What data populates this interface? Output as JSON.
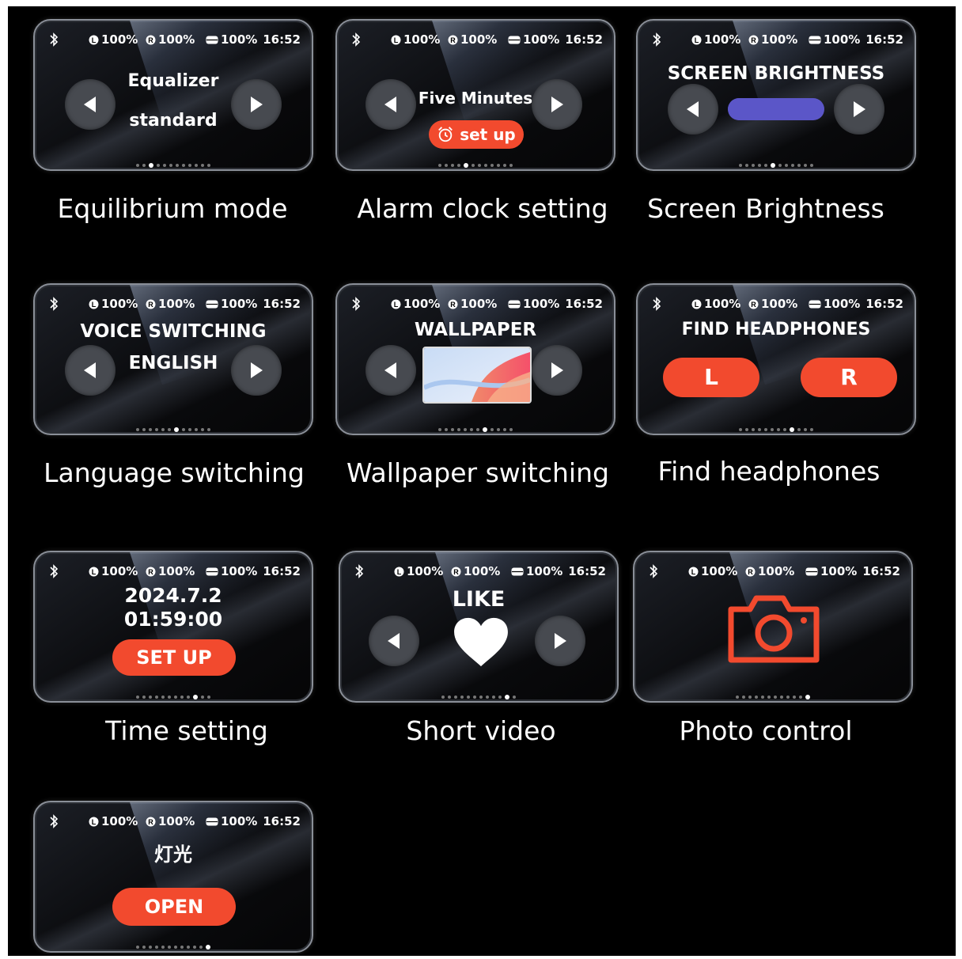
{
  "status_bar": {
    "items": [
      "100%",
      "100%",
      "100%"
    ],
    "time": "16:52"
  },
  "cards": [
    {
      "title": "Equalizer",
      "subtitle": "standard",
      "caption": "Equilibrium mode",
      "dot_count": 12,
      "active_dot": 2
    },
    {
      "title": "Five Minutes",
      "button": "set up",
      "caption": "Alarm clock setting",
      "dot_count": 12,
      "active_dot": 4
    },
    {
      "title": "SCREEN BRIGHTNESS",
      "caption": "Screen Brightness",
      "dot_count": 12,
      "active_dot": 5,
      "brightness_level": 0.4
    },
    {
      "title": "VOICE SWITCHING",
      "subtitle": "ENGLISH",
      "caption": "Language switching",
      "dot_count": 12,
      "active_dot": 6
    },
    {
      "title": "WALLPAPER",
      "caption": "Wallpaper switching",
      "dot_count": 12,
      "active_dot": 7
    },
    {
      "title": "FIND HEADPHONES",
      "left_button": "L",
      "right_button": "R",
      "caption": "Find headphones",
      "dot_count": 12,
      "active_dot": 8
    },
    {
      "title": "2024.7.2",
      "subtitle": "01:59:00",
      "button": "SET UP",
      "caption": "Time setting",
      "dot_count": 12,
      "active_dot": 9
    },
    {
      "title": "LIKE",
      "caption": "Short video",
      "dot_count": 12,
      "active_dot": 10
    },
    {
      "caption": "Photo control",
      "dot_count": 12,
      "active_dot": 11
    },
    {
      "title": "灯光",
      "button": "OPEN",
      "caption": "",
      "dot_count": 12,
      "active_dot": 11
    }
  ],
  "colors": {
    "accent": "#f24a2e",
    "brightness_bar": "#5b56c8",
    "arrow_bg": "#474a50"
  }
}
